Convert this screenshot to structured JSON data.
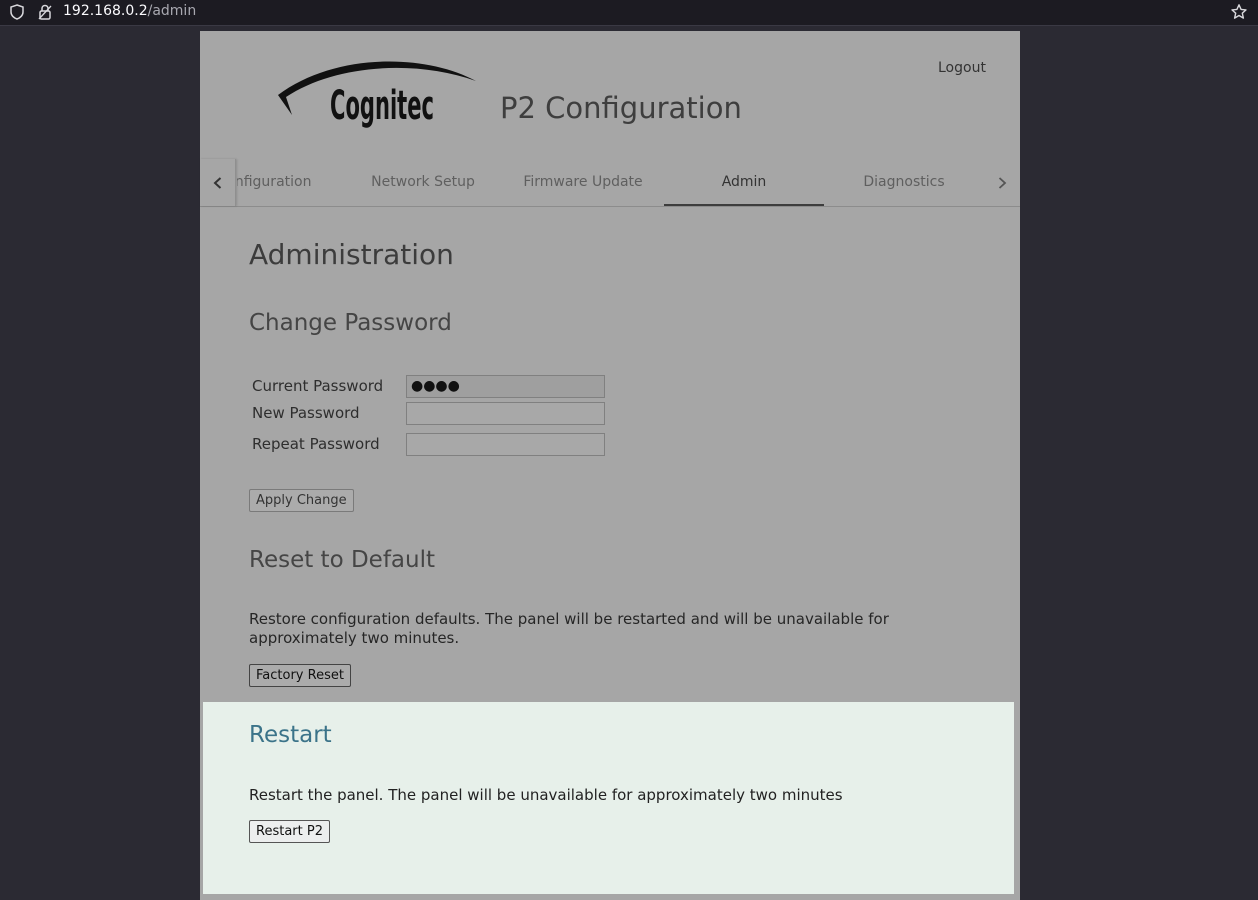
{
  "browser": {
    "url_host": "192.168.0.2",
    "url_path": "/admin"
  },
  "header": {
    "logo_text": "Cognitec",
    "app_title": "P2 Configuration",
    "logout_label": "Logout"
  },
  "tabs": [
    {
      "label": "Configuration",
      "visible_label": "nfiguration"
    },
    {
      "label": "Network Setup"
    },
    {
      "label": "Firmware Update"
    },
    {
      "label": "Admin",
      "active": true
    },
    {
      "label": "Diagnostics"
    }
  ],
  "page": {
    "title": "Administration"
  },
  "change_password": {
    "heading": "Change Password",
    "current_label": "Current Password",
    "current_value": "●●●●",
    "new_label": "New Password",
    "repeat_label": "Repeat Password",
    "apply_label": "Apply Change"
  },
  "reset": {
    "heading": "Reset to Default",
    "description_line1": "Restore configuration defaults. The panel will be restarted and will be unavailable for",
    "description_line2": "approximately two minutes.",
    "button_label": "Factory Reset"
  },
  "restart": {
    "heading": "Restart",
    "description": "Restart the panel. The panel will be unavailable for approximately two minutes",
    "button_label": "Restart P2",
    "highlight_color": "#e7f0ea"
  },
  "icons": {
    "shield": "shield-icon",
    "lock": "lock-icon",
    "star": "star-icon",
    "chevron_left": "chevron-left-icon",
    "chevron_right": "chevron-right-icon"
  }
}
